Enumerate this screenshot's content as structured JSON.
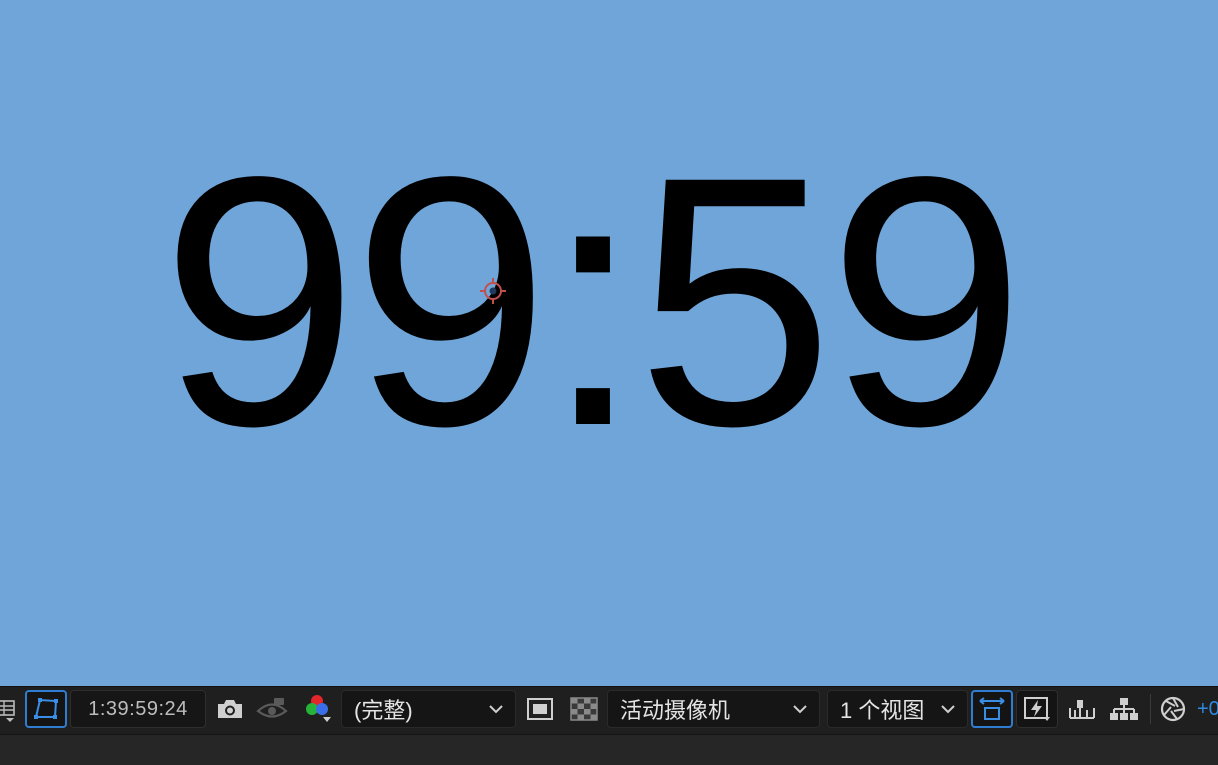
{
  "viewer": {
    "background_color": "#6fa5d8",
    "composition_text": "99:59"
  },
  "toolbar": {
    "timecode": "1:39:59:24",
    "resolution_value": "(完整)",
    "camera_value": "活动摄像机",
    "views_value": "1 个视图",
    "exposure_partial": "+0",
    "accent_color": "#2f7dd1"
  },
  "icons": {
    "grid": "grid-icon",
    "mask": "mask-path-icon",
    "snapshot": "camera-icon",
    "show_snapshot": "eye-icon",
    "channel": "rgb-channel-icon",
    "region": "region-of-interest-icon",
    "transparency": "transparency-grid-icon",
    "toggle_view": "toggle-view-layout-icon",
    "fast_preview": "fast-preview-icon",
    "timeline": "timeline-icon",
    "flowchart": "flowchart-icon",
    "exposure": "exposure-icon"
  }
}
